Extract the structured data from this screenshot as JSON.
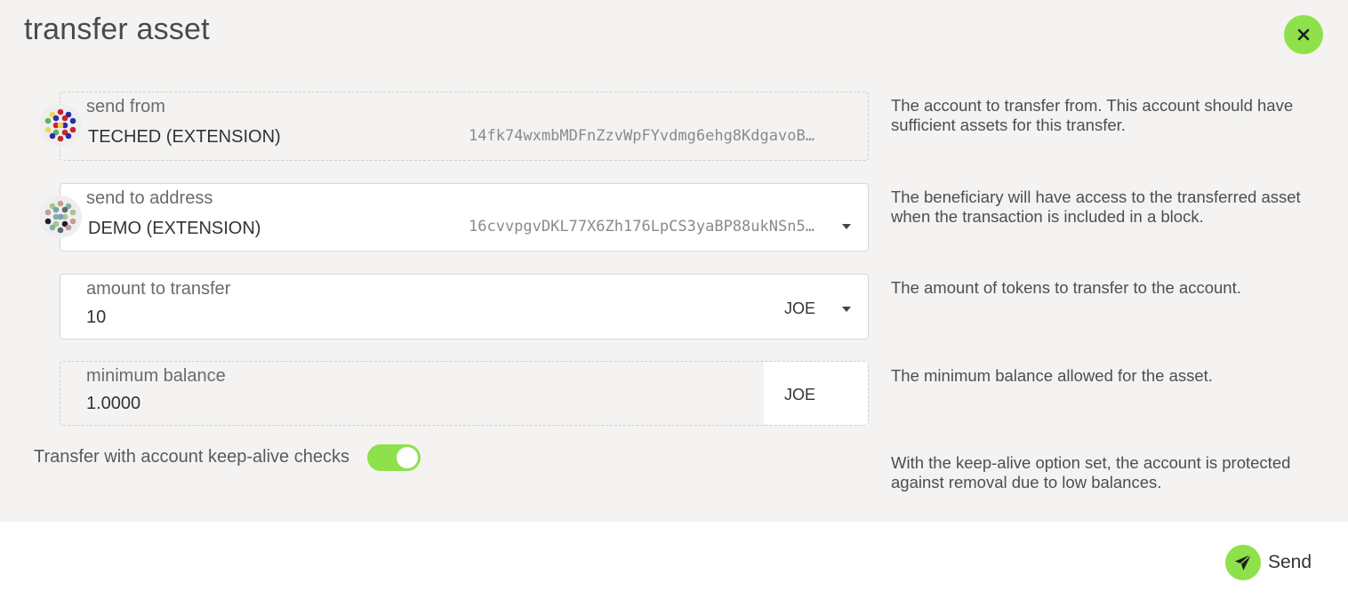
{
  "modal": {
    "title": "transfer asset",
    "close_icon": "close-icon"
  },
  "send_from": {
    "label": "send from",
    "account_name": "TECHED (EXTENSION)",
    "address": "14fk74wxmbMDFnZzvWpFYvdmg6ehg8KdgavoB…",
    "help": "The account to transfer from. This account should have sufficient assets for this transfer."
  },
  "send_to": {
    "label": "send to address",
    "account_name": "DEMO (EXTENSION)",
    "address": "16cvvpgvDKL77X6Zh176LpCS3yaBP88ukNSn5…",
    "help": "The beneficiary will have access to the transferred asset when the transaction is included in a block."
  },
  "amount": {
    "label": "amount to transfer",
    "value": "10",
    "unit": "JOE",
    "help": "The amount of tokens to transfer to the account."
  },
  "minimum_balance": {
    "label": "minimum balance",
    "value": "1.0000",
    "unit": "JOE",
    "help": "The minimum balance allowed for the asset."
  },
  "keep_alive": {
    "label": "Transfer with account keep-alive checks",
    "enabled": true,
    "help": "With the keep-alive option set, the account is protected against removal due to low balances."
  },
  "actions": {
    "send_label": "Send",
    "send_icon": "paper-plane-icon"
  },
  "colors": {
    "accent": "#8fe14b",
    "background": "#f4f3f2"
  }
}
